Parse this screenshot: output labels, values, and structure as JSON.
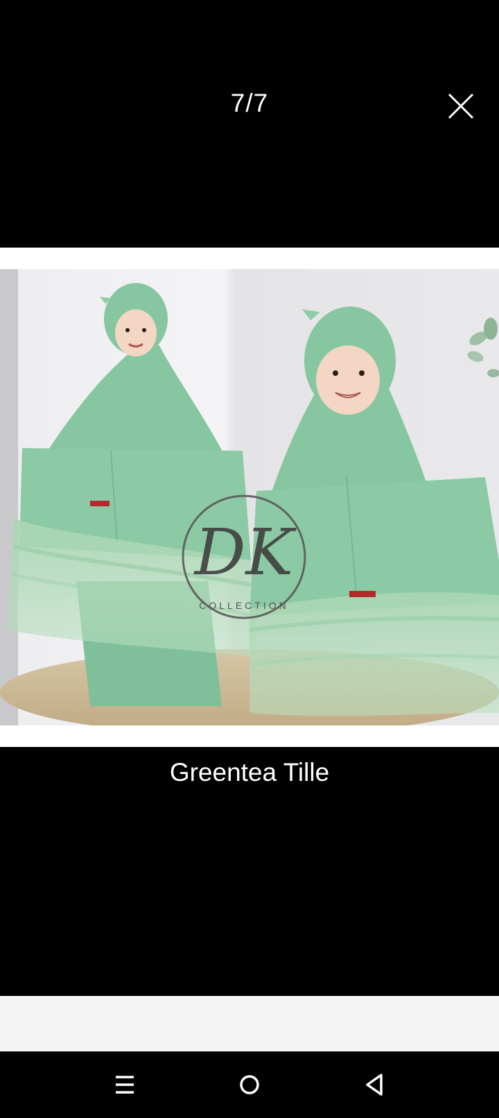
{
  "viewer": {
    "counter": "7/7",
    "caption": "Greentea Tille"
  },
  "photo": {
    "watermark_mark": "DK",
    "watermark_text": "COLLECTION",
    "dress_color": "#8ec9a4",
    "background_color": "#e8e8ea"
  },
  "icons": {
    "close": "close-icon",
    "recents": "menu-lines-icon",
    "home": "circle-home-icon",
    "back": "triangle-back-icon"
  },
  "colors": {
    "background": "#000000",
    "text": "#ffffff",
    "strip": "#f4f4f4"
  }
}
